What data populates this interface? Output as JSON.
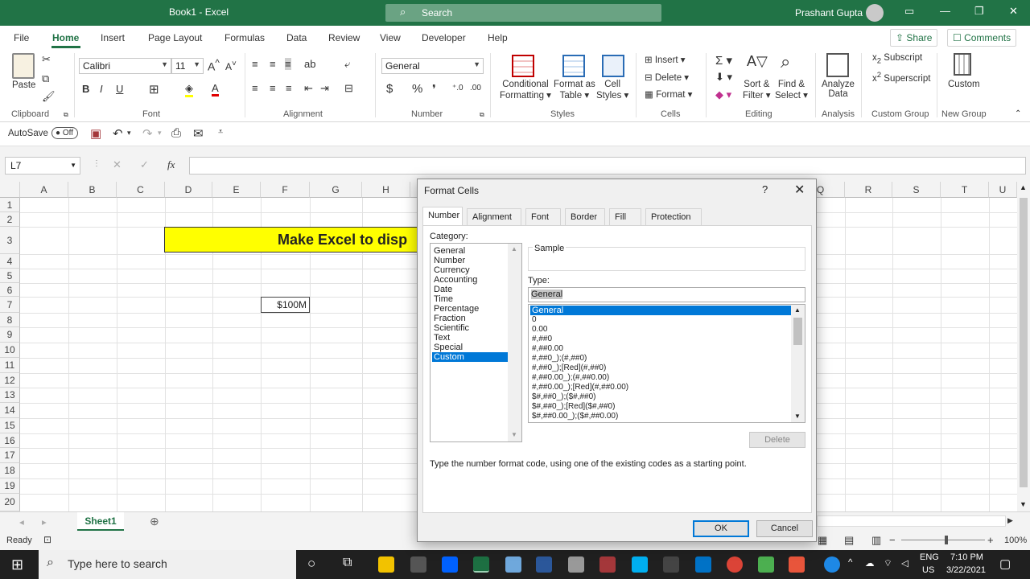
{
  "window": {
    "title": "Book1 - Excel",
    "search_placeholder": "Search",
    "user": "Prashant Gupta"
  },
  "menu": {
    "items": [
      "File",
      "Home",
      "Insert",
      "Page Layout",
      "Formulas",
      "Data",
      "Review",
      "View",
      "Developer",
      "Help"
    ],
    "active": "Home",
    "share": "Share",
    "comments": "Comments"
  },
  "ribbon": {
    "paste": "Paste",
    "font_name": "Calibri",
    "font_size": "11",
    "number_format": "General",
    "conditional_formatting": [
      "Conditional",
      "Formatting"
    ],
    "format_as_table": [
      "Format as",
      "Table"
    ],
    "cell_styles": [
      "Cell",
      "Styles"
    ],
    "insert": "Insert",
    "delete": "Delete",
    "format": "Format",
    "sort_filter": [
      "Sort &",
      "Filter"
    ],
    "find_select": [
      "Find &",
      "Select"
    ],
    "analyze_data": [
      "Analyze",
      "Data"
    ],
    "subscript": "Subscript",
    "superscript": "Superscript",
    "custom": "Custom",
    "groups": [
      "Clipboard",
      "Font",
      "Alignment",
      "Number",
      "Styles",
      "Cells",
      "Editing",
      "Analysis",
      "Custom Group",
      "New Group"
    ]
  },
  "qat": {
    "autosave": "AutoSave",
    "autosave_state": "Off"
  },
  "formula_bar": {
    "name_box": "L7",
    "fx": "fx",
    "content": ""
  },
  "sheet": {
    "columns": [
      "A",
      "B",
      "C",
      "D",
      "E",
      "F",
      "G",
      "H",
      "I",
      "J",
      "K",
      "L",
      "M",
      "N",
      "O",
      "P",
      "Q",
      "R",
      "S",
      "T",
      "U"
    ],
    "rows": [
      "1",
      "2",
      "3",
      "4",
      "5",
      "6",
      "7",
      "8",
      "9",
      "10",
      "11",
      "12",
      "13",
      "14",
      "15",
      "16",
      "17",
      "18",
      "19",
      "20"
    ],
    "banner_text": "Make Excel to disp",
    "cell_f7": "$100M",
    "tab": "Sheet1"
  },
  "status": {
    "ready": "Ready",
    "zoom": "100%"
  },
  "taskbar": {
    "search_placeholder": "Type here to search",
    "lang": "ENG",
    "region": "US",
    "time": "7:10 PM",
    "date": "3/22/2021"
  },
  "dialog": {
    "title": "Format Cells",
    "help": "?",
    "close": "✕",
    "tabs": [
      "Number",
      "Alignment",
      "Font",
      "Border",
      "Fill",
      "Protection"
    ],
    "category_label": "Category:",
    "categories": [
      "General",
      "Number",
      "Currency",
      "Accounting",
      "Date",
      "Time",
      "Percentage",
      "Fraction",
      "Scientific",
      "Text",
      "Special",
      "Custom"
    ],
    "selected_category": "Custom",
    "sample_label": "Sample",
    "type_label": "Type:",
    "type_value": "General",
    "types": [
      "General",
      "0",
      "0.00",
      "#,##0",
      "#,##0.00",
      "#,##0_);(#,##0)",
      "#,##0_);[Red](#,##0)",
      "#,##0.00_);(#,##0.00)",
      "#,##0.00_);[Red](#,##0.00)",
      "$#,##0_);($#,##0)",
      "$#,##0_);[Red]($#,##0)",
      "$#,##0.00_);($#,##0.00)"
    ],
    "delete": "Delete",
    "hint": "Type the number format code, using one of the existing codes as a starting point.",
    "ok": "OK",
    "cancel": "Cancel"
  }
}
